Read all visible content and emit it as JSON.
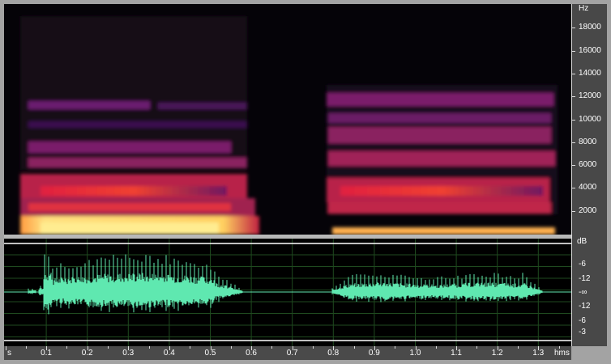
{
  "frequency_axis": {
    "unit": "Hz",
    "labels": [
      "18000",
      "16000",
      "14000",
      "12000",
      "10000",
      "8000",
      "6000",
      "4000",
      "2000"
    ]
  },
  "amplitude_axis": {
    "unit": "dB",
    "labels": [
      "-6",
      "-12",
      "-∞",
      "-12",
      "-6",
      "-3"
    ]
  },
  "time_ruler": {
    "start_label": "s",
    "end_label": "hms",
    "labels": [
      "0.1",
      "0.2",
      "0.3",
      "0.4",
      "0.5",
      "0.6",
      "0.7",
      "0.8",
      "0.9",
      "1.0",
      "1.1",
      "1.2",
      "1.3"
    ]
  },
  "colors": {
    "waveform": "#5fe8b0",
    "grid": "#1f4a1f",
    "spectral_hot": "#ffd060",
    "spectral_mid": "#e0204a",
    "spectral_low": "#6a1a70"
  }
}
